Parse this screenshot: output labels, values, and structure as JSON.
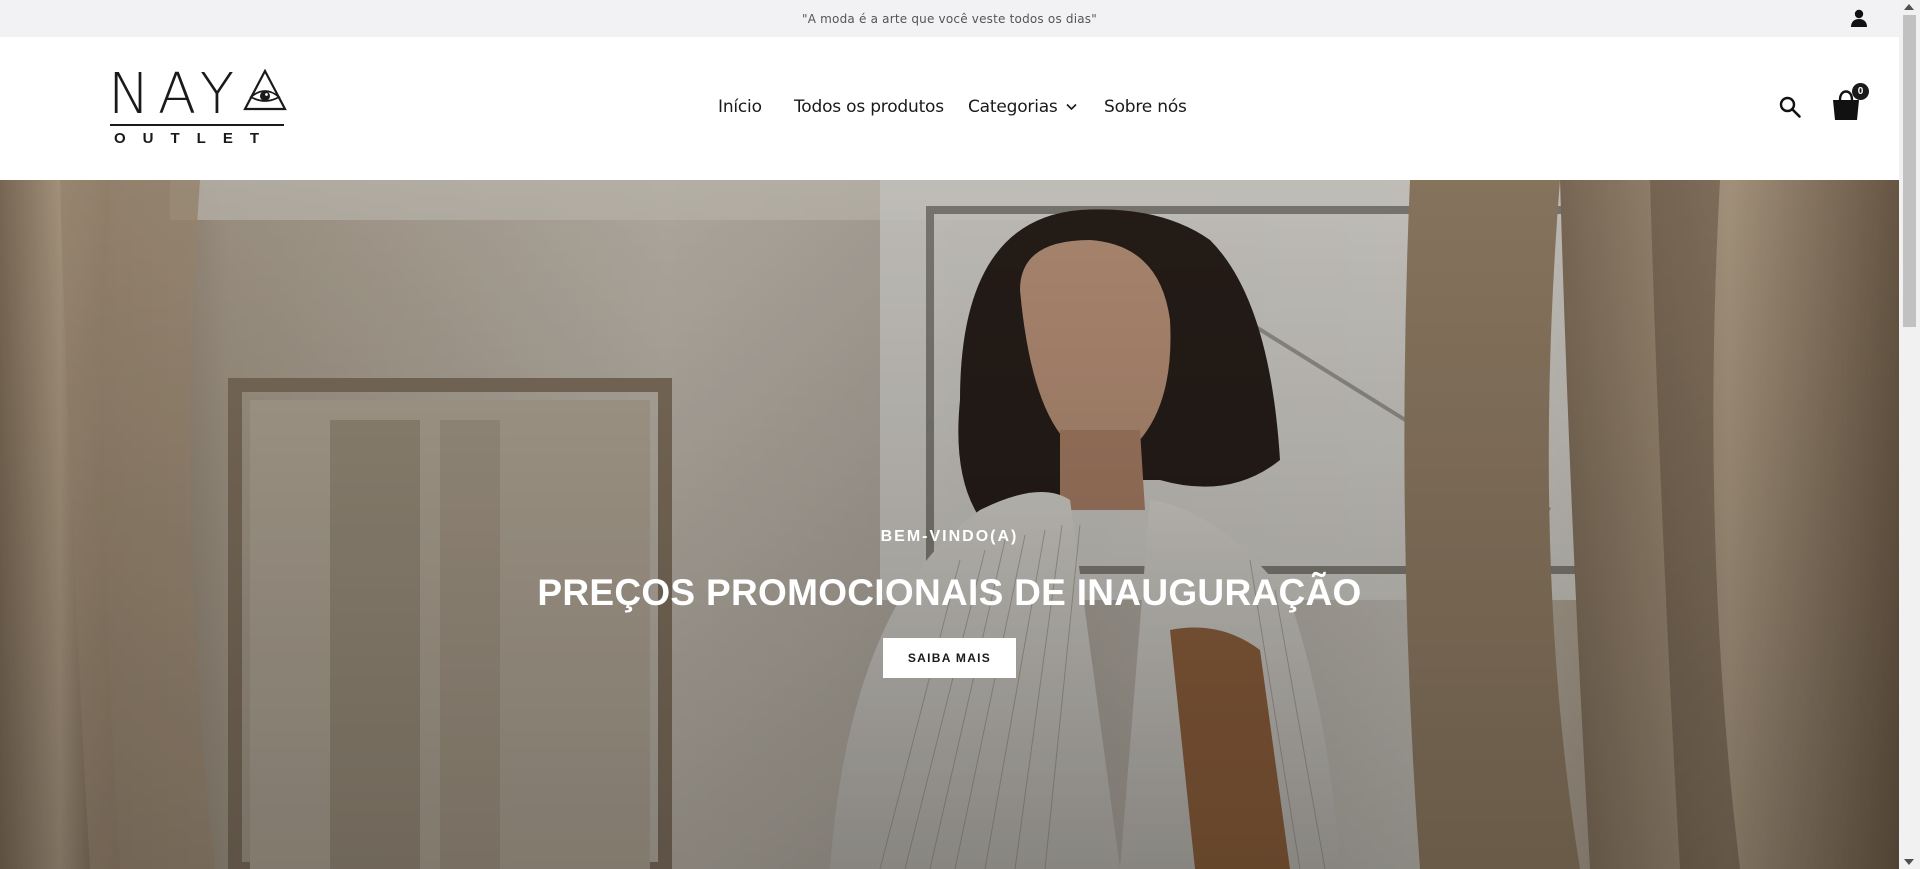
{
  "announcement": {
    "text": "\"A moda é a arte que você veste todos os dias\""
  },
  "header": {
    "logo": {
      "wordmark": "NAY",
      "subtitle": "OUTLET"
    },
    "nav": [
      {
        "label": "Início"
      },
      {
        "label": "Todos os produtos"
      },
      {
        "label": "Categorias",
        "has_dropdown": true
      },
      {
        "label": "Sobre nós"
      }
    ],
    "cart": {
      "count": "0"
    },
    "icons": [
      "account-icon",
      "search-icon",
      "shopping-bag-icon",
      "chevron-down-icon"
    ]
  },
  "hero": {
    "eyebrow": "BEM-VINDO(A)",
    "headline": "PREÇOS PROMOCIONAIS DE INAUGURAÇÃO",
    "button_label": "SAIBA MAIS"
  },
  "colors": {
    "topbar_bg": "#f2f2f4",
    "text": "#1a1a1a",
    "hero_overlay_text": "#ffffff"
  }
}
